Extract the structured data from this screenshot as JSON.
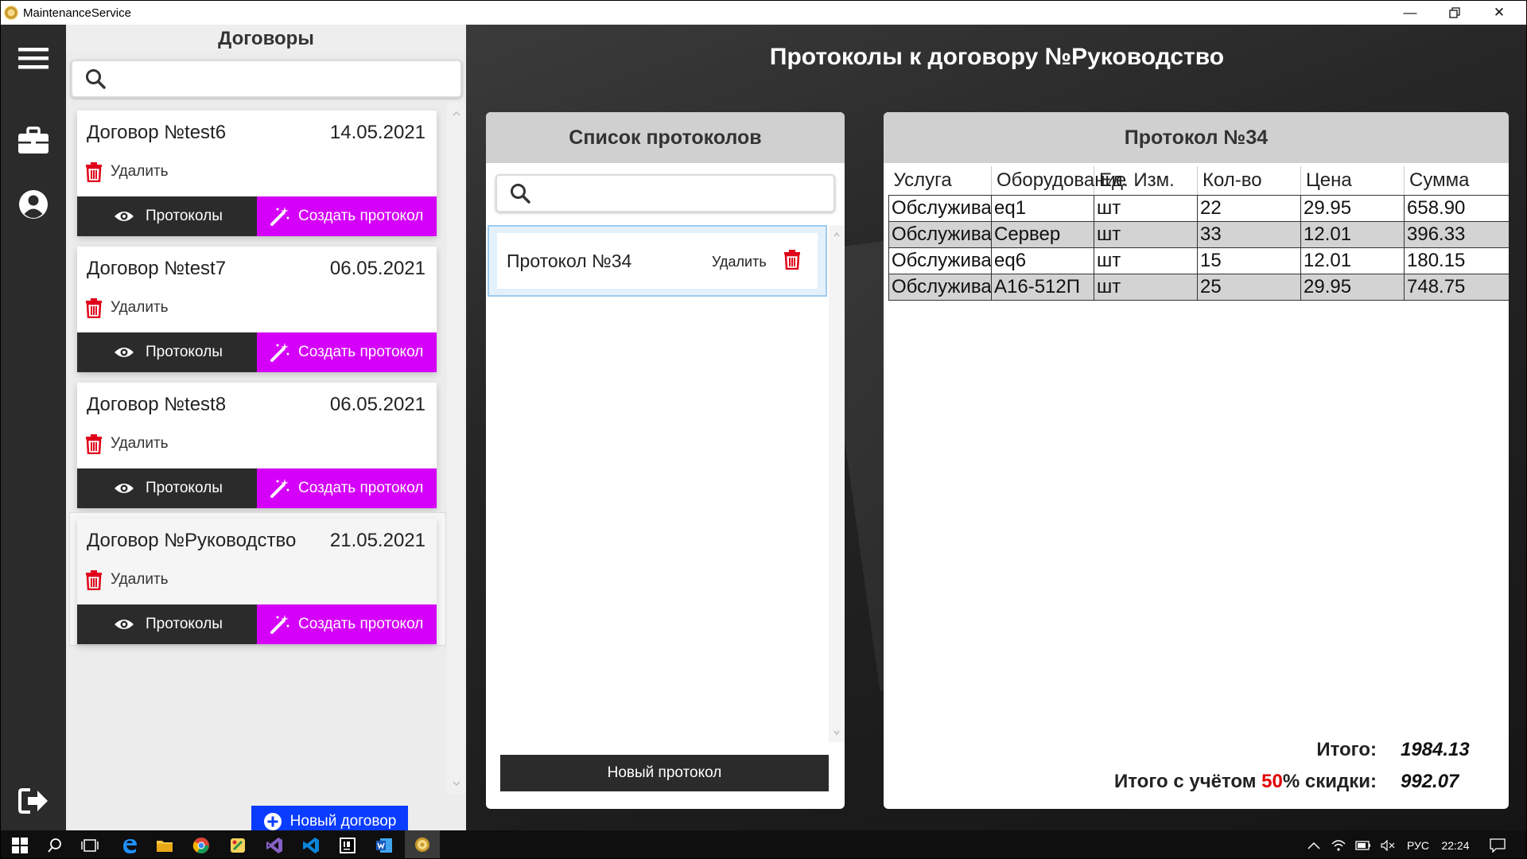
{
  "window": {
    "title": "MaintenanceService"
  },
  "left_panel": {
    "title": "Договоры",
    "search_placeholder": "",
    "delete_label": "Удалить",
    "protocols_label": "Протоколы",
    "create_label": "Создать протокол",
    "new_contract_label": "Новый договор",
    "contracts": [
      {
        "name": "Договор №test6",
        "date": "14.05.2021"
      },
      {
        "name": "Договор №test7",
        "date": "06.05.2021"
      },
      {
        "name": "Договор №test8",
        "date": "06.05.2021"
      },
      {
        "name": "Договор №Руководство",
        "date": "21.05.2021",
        "selected": true
      }
    ]
  },
  "main": {
    "title": "Протоколы к договору №Руководство",
    "protocol_list": {
      "title": "Список протоколов",
      "search_placeholder": "",
      "items": [
        {
          "name": "Протокол №34",
          "delete_label": "Удалить"
        }
      ],
      "new_label": "Новый протокол"
    },
    "protocol": {
      "title": "Протокол №34",
      "columns": [
        "Услуга",
        "Оборудование",
        "Ед. Изм.",
        "Кол-во",
        "Цена",
        "Сумма"
      ],
      "rows": [
        [
          "Обслуживание",
          "eq1",
          "шт",
          "22",
          "29.95",
          "658.90"
        ],
        [
          "Обслуживание",
          "Сервер",
          "шт",
          "33",
          "12.01",
          "396.33"
        ],
        [
          "Обслуживание",
          "eq6",
          "шт",
          "15",
          "12.01",
          "180.15"
        ],
        [
          "Обслуживание",
          "А16-512П",
          "шт",
          "25",
          "29.95",
          "748.75"
        ]
      ],
      "total_label": "Итого:",
      "total_value": "1984.13",
      "discount_prefix": "Итого с учётом ",
      "discount_percent": "50",
      "discount_suffix": "% скидки:",
      "discount_value": "992.07"
    }
  },
  "taskbar": {
    "lang": "РУС",
    "time": "22:24"
  },
  "colors": {
    "accent_magenta": "#d500f9",
    "primary_blue": "#0a3cff",
    "dark": "#2b2b2b",
    "delete_red": "#e0001a",
    "discount_red": "#e00000"
  }
}
